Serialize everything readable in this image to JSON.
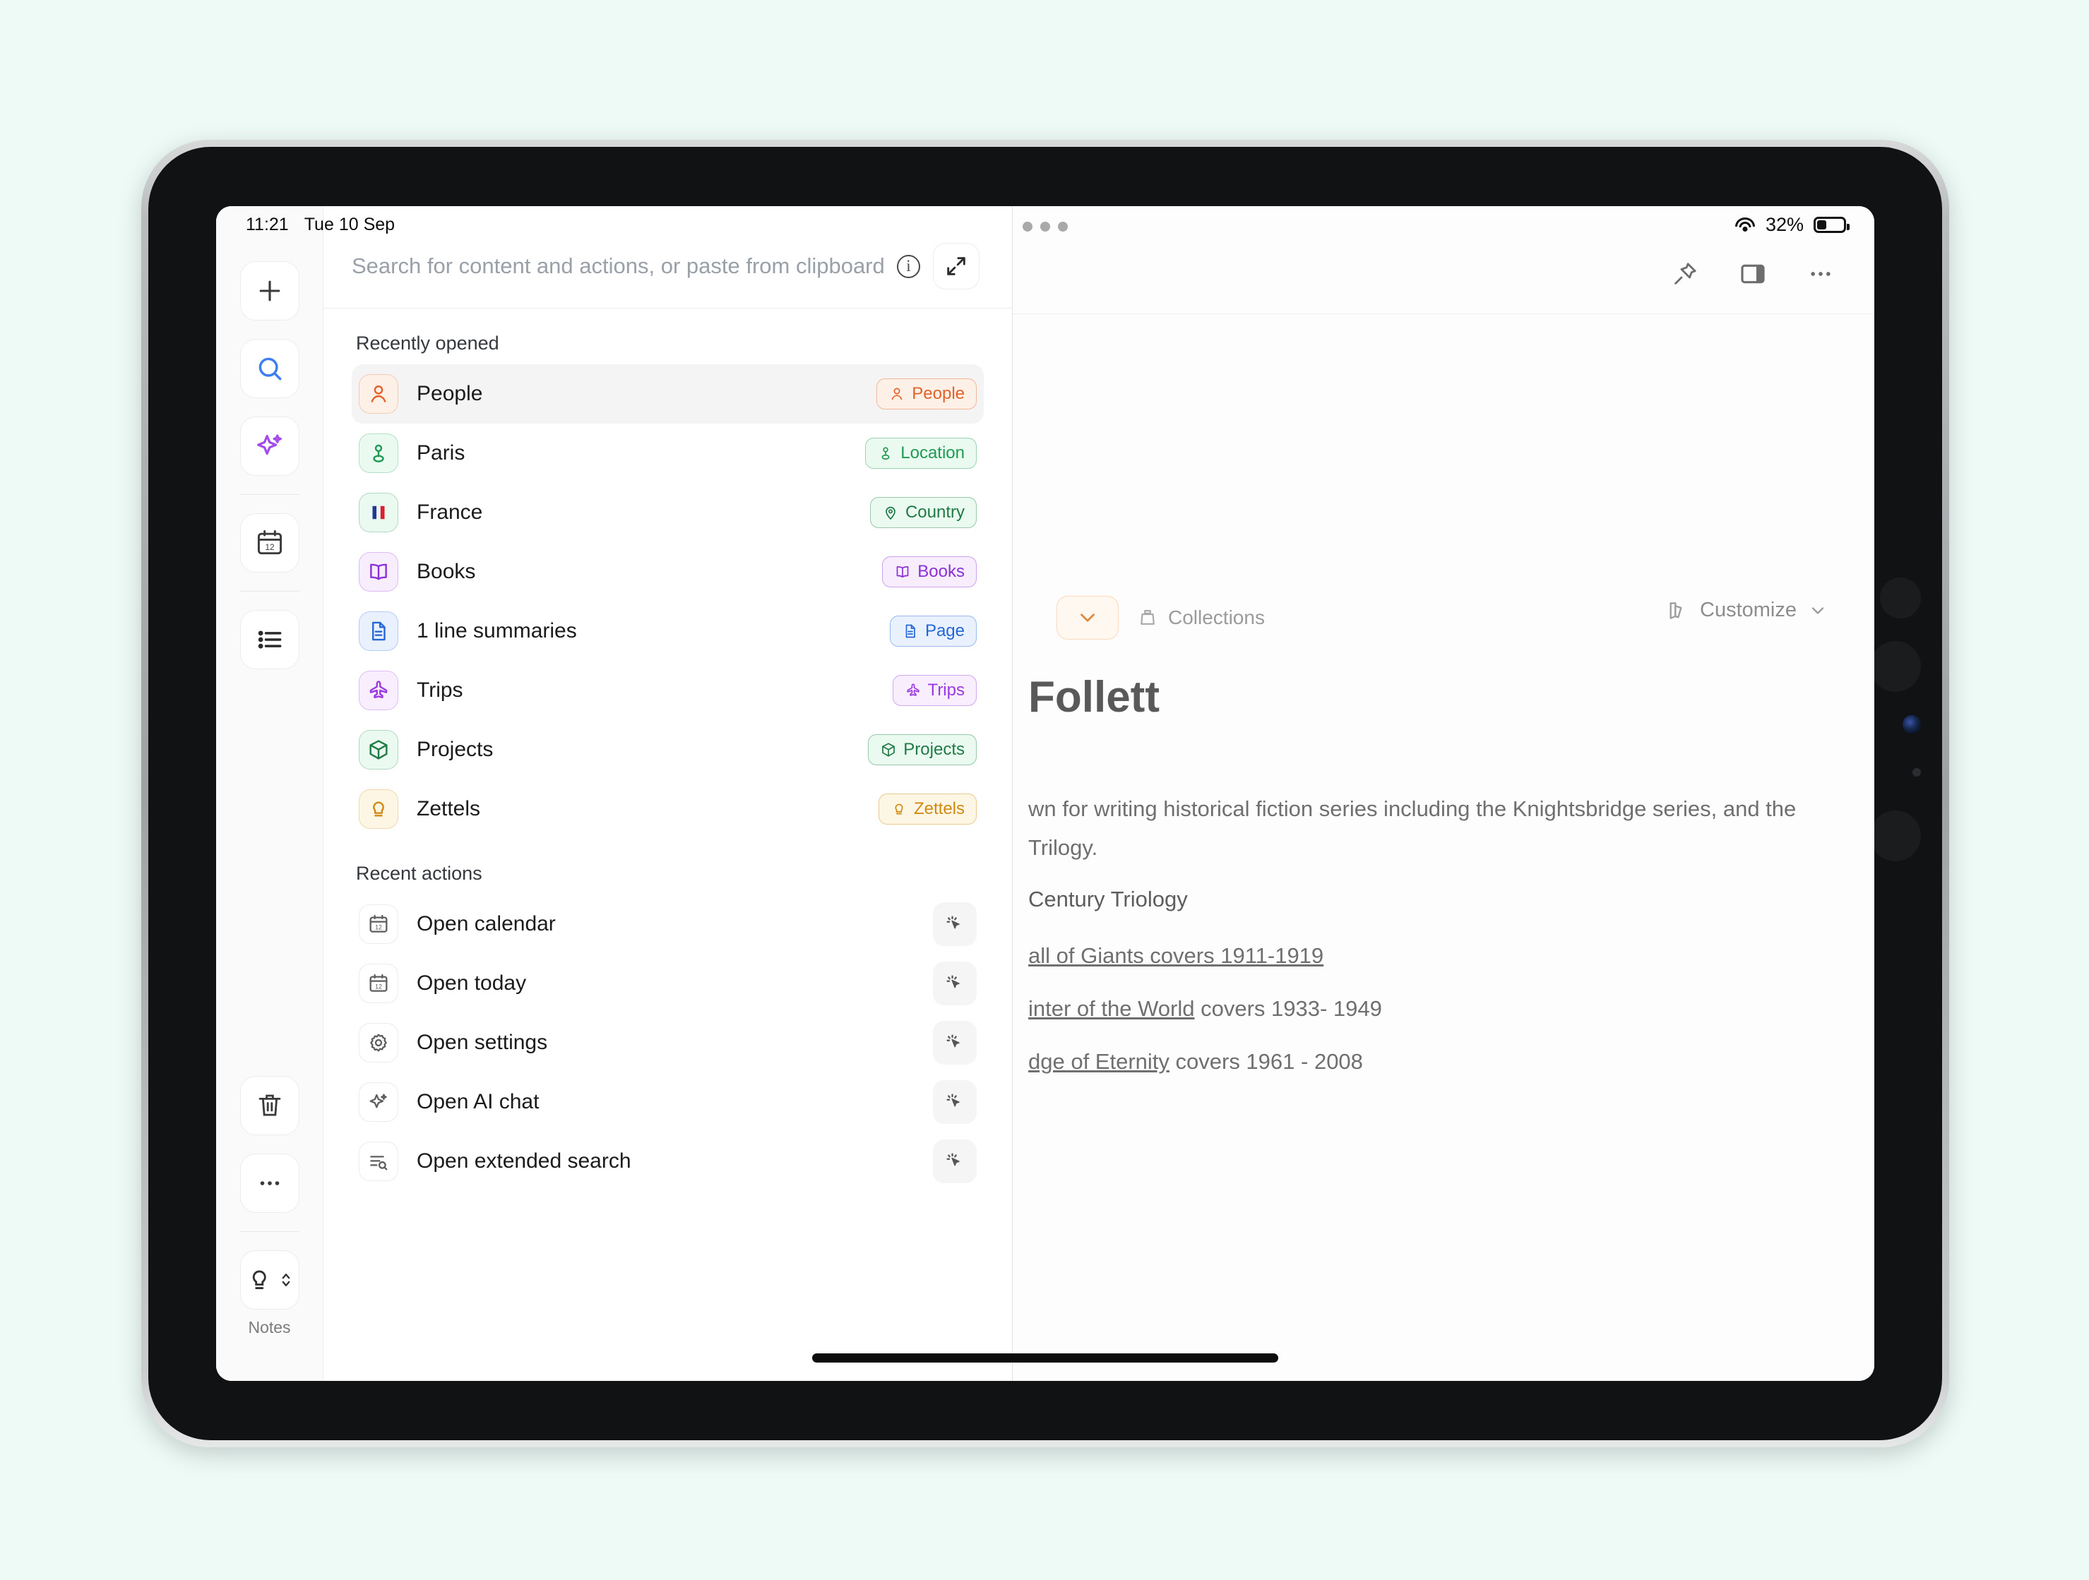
{
  "statusbar": {
    "time": "11:21",
    "date": "Tue 10 Sep",
    "battery_pct": "32%",
    "wifi_icon": "wifi-icon",
    "battery_icon": "battery-icon"
  },
  "rail": {
    "items": [
      {
        "name": "add-button",
        "icon": "plus-icon"
      },
      {
        "name": "search-button",
        "icon": "magnifier-icon"
      },
      {
        "name": "ai-button",
        "icon": "sparkle-icon"
      },
      {
        "name": "calendar-button",
        "icon": "calendar-12-icon"
      },
      {
        "name": "list-button",
        "icon": "bulleted-list-icon"
      }
    ],
    "bottom_items": [
      {
        "name": "trash-button",
        "icon": "trash-icon"
      },
      {
        "name": "more-button",
        "icon": "ellipsis-icon"
      }
    ],
    "space_switcher": {
      "icon": "lightbulb-icon",
      "chevron": "chevron-updown-icon",
      "label": "Notes"
    }
  },
  "search": {
    "placeholder": "Search for content and actions, or paste from clipboard",
    "value": "",
    "info_icon": "info-icon",
    "expand_icon": "expand-diagonal-icon"
  },
  "recently_opened": {
    "title": "Recently opened",
    "items": [
      {
        "label": "People",
        "icon": "person-icon",
        "chip": "People",
        "chip_icon": "person-icon",
        "color": "#e2622a",
        "bg": "#fdf1e7",
        "selected": true
      },
      {
        "label": "Paris",
        "icon": "map-pin-icon",
        "chip": "Location",
        "chip_icon": "map-pin-icon",
        "color": "#1f9a52",
        "bg": "#eafaf0",
        "selected": false
      },
      {
        "label": "France",
        "icon": "flag-fr-icon",
        "chip": "Country",
        "chip_icon": "location-icon",
        "color": "#1f7a45",
        "bg": "#eafaf0",
        "selected": false
      },
      {
        "label": "Books",
        "icon": "book-icon",
        "chip": "Books",
        "chip_icon": "book-icon",
        "color": "#8b2fd6",
        "bg": "#f7edfd",
        "selected": false
      },
      {
        "label": "1 line summaries",
        "icon": "document-icon",
        "chip": "Page",
        "chip_icon": "document-icon",
        "color": "#2667d8",
        "bg": "#e8f1fd",
        "selected": false
      },
      {
        "label": "Trips",
        "icon": "airplane-icon",
        "chip": "Trips",
        "chip_icon": "airplane-icon",
        "color": "#9b3ae0",
        "bg": "#f8eefe",
        "selected": false
      },
      {
        "label": "Projects",
        "icon": "package-icon",
        "chip": "Projects",
        "chip_icon": "package-icon",
        "color": "#1f7a45",
        "bg": "#eafaf0",
        "selected": false
      },
      {
        "label": "Zettels",
        "icon": "lightbulb-icon",
        "chip": "Zettels",
        "chip_icon": "lightbulb-icon",
        "color": "#d08a12",
        "bg": "#fdf6e4",
        "selected": false
      }
    ]
  },
  "recent_actions": {
    "title": "Recent actions",
    "items": [
      {
        "label": "Open calendar",
        "icon": "calendar-12-icon",
        "action_icon": "click-cursor-icon"
      },
      {
        "label": "Open today",
        "icon": "calendar-12-icon",
        "action_icon": "click-cursor-icon"
      },
      {
        "label": "Open settings",
        "icon": "gear-icon",
        "action_icon": "click-cursor-icon"
      },
      {
        "label": "Open AI chat",
        "icon": "sparkle-icon",
        "action_icon": "click-cursor-icon"
      },
      {
        "label": "Open extended search",
        "icon": "search-list-icon",
        "action_icon": "click-cursor-icon"
      }
    ]
  },
  "document": {
    "window_handle_icon": "drag-handle-dots-icon",
    "toolbar": [
      {
        "name": "pin-button",
        "icon": "pin-icon"
      },
      {
        "name": "panel-button",
        "icon": "side-panel-icon"
      },
      {
        "name": "more-button",
        "icon": "ellipsis-icon"
      }
    ],
    "breadcrumb": {
      "chevron_icon": "chevron-down-icon",
      "collection_icon": "collections-icon",
      "label": "Collections"
    },
    "customize": {
      "icon": "palette-icon",
      "label": "Customize",
      "chevron_icon": "chevron-down-icon"
    },
    "title": "Follett",
    "paragraph_1": "wn for writing historical fiction series including the Knightsbridge series, and the",
    "paragraph_2": "Trilogy.",
    "heading_1": "Century Triology",
    "line_1_link": "all of Giants covers 1911-1919",
    "line_2_link": "inter of the World",
    "line_2_rest": " covers 1933- 1949",
    "line_3_link": "dge of Eternity",
    "line_3_rest": " covers 1961 - 2008"
  }
}
